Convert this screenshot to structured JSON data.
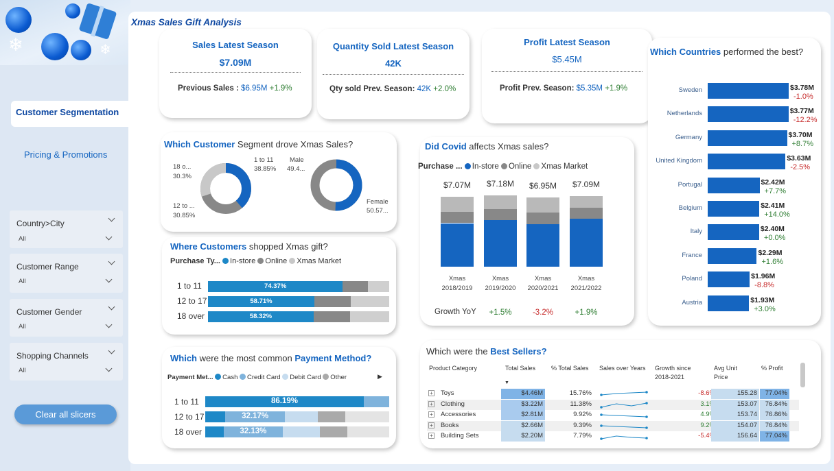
{
  "title": "Xmas Sales Gift Analysis",
  "nav": {
    "items": [
      {
        "label": "Customer Segmentation",
        "active": true
      },
      {
        "label": "Pricing & Promotions",
        "active": false
      }
    ],
    "clear_label": "Clear all slicers"
  },
  "slicers": [
    {
      "label": "Country>City",
      "value": "All"
    },
    {
      "label": "Customer Range",
      "value": "All"
    },
    {
      "label": "Customer Gender",
      "value": "All"
    },
    {
      "label": "Shopping Channels",
      "value": "All"
    }
  ],
  "kpis": {
    "sales": {
      "title": "Sales Latest Season",
      "value": "$7.09M",
      "prev_label": "Previous Sales :",
      "prev_value": "$6.95M",
      "change": "+1.9%"
    },
    "quantity": {
      "title": "Quantity Sold Latest Season",
      "value": "42K",
      "prev_label": "Qty sold Prev. Season:",
      "prev_value": "42K",
      "change": "+2.0%"
    },
    "profit": {
      "title": "Profit Latest Season",
      "value": "$5.45M",
      "prev_label": "Profit Prev. Season:",
      "prev_value": "$5.35M",
      "change": "+1.9%"
    }
  },
  "segment": {
    "title_bold": "Which Customer",
    "title_rest": " Segment drove Xmas Sales?",
    "age": {
      "labels": [
        "1 to 11",
        "38.85%",
        "18 o...",
        "30.3%",
        "12 to ...",
        "30.85%"
      ],
      "values": [
        38.85,
        30.85,
        30.3
      ]
    },
    "gender": {
      "labels": [
        "Male",
        "49.4...",
        "Female",
        "50.57..."
      ],
      "values": [
        49.43,
        50.57
      ]
    }
  },
  "where": {
    "title_bold": "Where Customers",
    "title_rest": " shopped Xmas gift?",
    "legend_title": "Purchase Ty...",
    "legend": [
      "In-store",
      "Online",
      "Xmas Market"
    ],
    "rows": [
      {
        "label": "1 to 11",
        "pct": "74.37%",
        "instore": 74.37,
        "online": 14
      },
      {
        "label": "12 to 17",
        "pct": "58.71%",
        "instore": 58.71,
        "online": 20
      },
      {
        "label": "18 over",
        "pct": "58.32%",
        "instore": 58.32,
        "online": 20
      }
    ]
  },
  "payment": {
    "title_a": "Which",
    "title_b": " were the most common ",
    "title_c": "Payment Method?",
    "legend_title": "Payment Met...",
    "legend": [
      "Cash",
      "Credit Card",
      "Debit Card",
      "Other"
    ],
    "rows": [
      {
        "label": "1 to 11",
        "pct": "86.19%",
        "cash": 86.19,
        "credit": 13.81,
        "debit": 0,
        "other": 0
      },
      {
        "label": "12 to 17",
        "pct": "32.17%",
        "cash": 11,
        "credit": 32.17,
        "debit": 18,
        "other": 15
      },
      {
        "label": "18 over",
        "pct": "32.13%",
        "cash": 10,
        "credit": 32.13,
        "debit": 20,
        "other": 15
      }
    ]
  },
  "covid": {
    "title_bold": "Did Covid",
    "title_rest": " affects Xmas sales?",
    "legend_title": "Purchase ...",
    "legend": [
      "In-store",
      "Online",
      "Xmas Market"
    ],
    "growth_label": "Growth YoY",
    "seasons": [
      {
        "total": "$7.07M",
        "l1": "Xmas",
        "l2": "2018/2019",
        "total_value": 7.07,
        "instore": 0.62,
        "online": 0.16,
        "market": 0.22,
        "growth": ""
      },
      {
        "total": "$7.18M",
        "l1": "Xmas",
        "l2": "2019/2020",
        "total_value": 7.18,
        "instore": 0.65,
        "online": 0.16,
        "market": 0.19,
        "growth": "+1.5%"
      },
      {
        "total": "$6.95M",
        "l1": "Xmas",
        "l2": "2020/2021",
        "total_value": 6.95,
        "instore": 0.62,
        "online": 0.16,
        "market": 0.22,
        "growth": "-3.2%"
      },
      {
        "total": "$7.09M",
        "l1": "Xmas",
        "l2": "2021/2022",
        "total_value": 7.09,
        "instore": 0.68,
        "online": 0.16,
        "market": 0.16,
        "growth": "+1.9%"
      }
    ]
  },
  "countries": {
    "title_bold": "Which Countries",
    "title_rest": " performed the best?",
    "items": [
      {
        "name": "Sweden",
        "value": "$3.78M",
        "change": "-1.0%",
        "v": 3.78
      },
      {
        "name": "Netherlands",
        "value": "$3.77M",
        "change": "-12.2%",
        "v": 3.77
      },
      {
        "name": "Germany",
        "value": "$3.70M",
        "change": "+8.7%",
        "v": 3.7
      },
      {
        "name": "United Kingdom",
        "value": "$3.63M",
        "change": "-2.5%",
        "v": 3.63
      },
      {
        "name": "Portugal",
        "value": "$2.42M",
        "change": "+7.7%",
        "v": 2.42
      },
      {
        "name": "Belgium",
        "value": "$2.41M",
        "change": "+14.0%",
        "v": 2.41
      },
      {
        "name": "Italy",
        "value": "$2.40M",
        "change": "+0.0%",
        "v": 2.4
      },
      {
        "name": "France",
        "value": "$2.29M",
        "change": "+1.6%",
        "v": 2.29
      },
      {
        "name": "Poland",
        "value": "$1.96M",
        "change": "-8.8%",
        "v": 1.96
      },
      {
        "name": "Austria",
        "value": "$1.93M",
        "change": "+3.0%",
        "v": 1.93
      }
    ]
  },
  "bestsellers": {
    "title_a": "Which were the ",
    "title_b": "Best Sellers?",
    "headers": [
      "Product Category",
      "Total Sales",
      "% Total Sales",
      "Sales over Years",
      "Growth since 2018-2021",
      "Avg Unit Price",
      "% Profit"
    ],
    "rows": [
      {
        "cat": "Toys",
        "sales": "$4.46M",
        "pct": "15.76%",
        "growth": "-8.6%",
        "price": "155.28",
        "profit": "77.04%"
      },
      {
        "cat": "Clothing",
        "sales": "$3.22M",
        "pct": "11.38%",
        "growth": "3.1%",
        "price": "153.07",
        "profit": "76.84%"
      },
      {
        "cat": "Accessories",
        "sales": "$2.81M",
        "pct": "9.92%",
        "growth": "4.9%",
        "price": "153.74",
        "profit": "76.86%"
      },
      {
        "cat": "Books",
        "sales": "$2.66M",
        "pct": "9.39%",
        "growth": "9.2%",
        "price": "154.07",
        "profit": "76.84%"
      },
      {
        "cat": "Building Sets",
        "sales": "$2.20M",
        "pct": "7.79%",
        "growth": "-5.4%",
        "price": "156.64",
        "profit": "77.04%"
      }
    ]
  },
  "colors": {
    "primary": "#1565c0",
    "grey": "#888888",
    "lightgrey": "#cfcfcf",
    "green": "#2e7d32",
    "red": "#c62828",
    "teal": "#1e88c7"
  }
}
